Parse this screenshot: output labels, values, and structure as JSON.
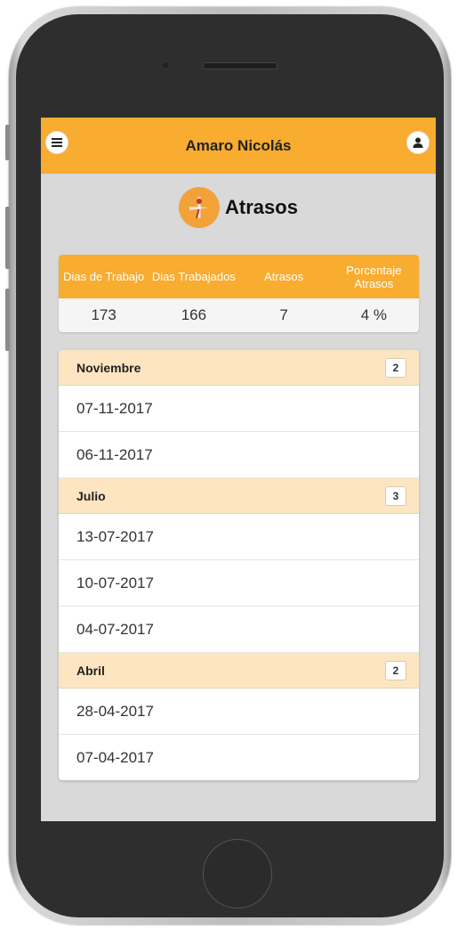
{
  "header": {
    "title": "Amaro Nicolás",
    "menu_icon": "menu-icon",
    "user_icon": "user-icon",
    "color": "#f8ac30"
  },
  "page": {
    "title": "Atrasos",
    "icon": "clock-hand-icon"
  },
  "stats": {
    "headers": [
      "Dias de Trabajo",
      "Dias Trabajados",
      "Atrasos",
      "Porcentaje Atrasos"
    ],
    "values": [
      "173",
      "166",
      "7",
      "4 %"
    ]
  },
  "groups": [
    {
      "name": "Noviembre",
      "count": "2",
      "dates": [
        "07-11-2017",
        "06-11-2017"
      ]
    },
    {
      "name": "Julio",
      "count": "3",
      "dates": [
        "13-07-2017",
        "10-07-2017",
        "04-07-2017"
      ]
    },
    {
      "name": "Abril",
      "count": "2",
      "dates": [
        "28-04-2017",
        "07-04-2017"
      ]
    }
  ]
}
